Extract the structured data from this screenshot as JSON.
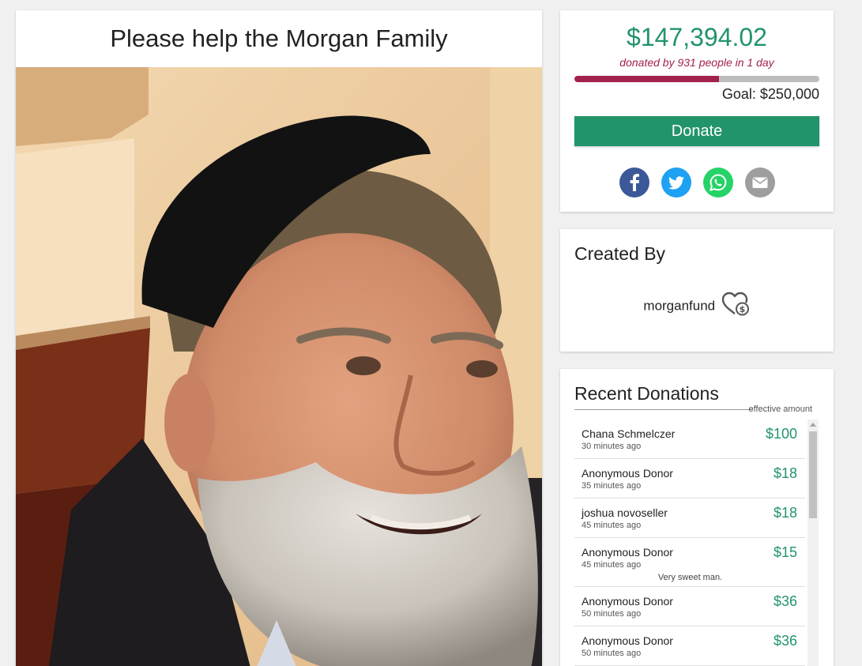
{
  "campaign": {
    "title": "Please help the Morgan Family",
    "photo": "portrait of a smiling elderly man with a gray beard and black kippah"
  },
  "summary": {
    "raised": "$147,394.02",
    "donated_by": "donated by 931 people in 1 day",
    "progress_fraction": 0.59,
    "goal": "Goal: $250,000",
    "donate_label": "Donate",
    "share": [
      {
        "name": "facebook-icon",
        "color": "#3b5998"
      },
      {
        "name": "twitter-icon",
        "color": "#1da1f2"
      },
      {
        "name": "whatsapp-icon",
        "color": "#25d366"
      },
      {
        "name": "email-icon",
        "color": "#9e9e9e"
      }
    ]
  },
  "creator": {
    "heading": "Created By",
    "name": "morganfund"
  },
  "donations": {
    "heading": "Recent Donations",
    "effective_label": "effective amount",
    "items": [
      {
        "name": "Chana Schmelczer",
        "time": "30 minutes ago",
        "amount": "$100",
        "comment": ""
      },
      {
        "name": "Anonymous Donor",
        "time": "35 minutes ago",
        "amount": "$18",
        "comment": ""
      },
      {
        "name": "joshua novoseller",
        "time": "45 minutes ago",
        "amount": "$18",
        "comment": ""
      },
      {
        "name": "Anonymous Donor",
        "time": "45 minutes ago",
        "amount": "$15",
        "comment": "Very sweet man."
      },
      {
        "name": "Anonymous Donor",
        "time": "50 minutes ago",
        "amount": "$36",
        "comment": ""
      },
      {
        "name": "Anonymous Donor",
        "time": "50 minutes ago",
        "amount": "$36",
        "comment": ""
      }
    ]
  },
  "colors": {
    "accent_green": "#22946a",
    "accent_maroon": "#a3214e",
    "progress_track": "#bdbdbd"
  }
}
